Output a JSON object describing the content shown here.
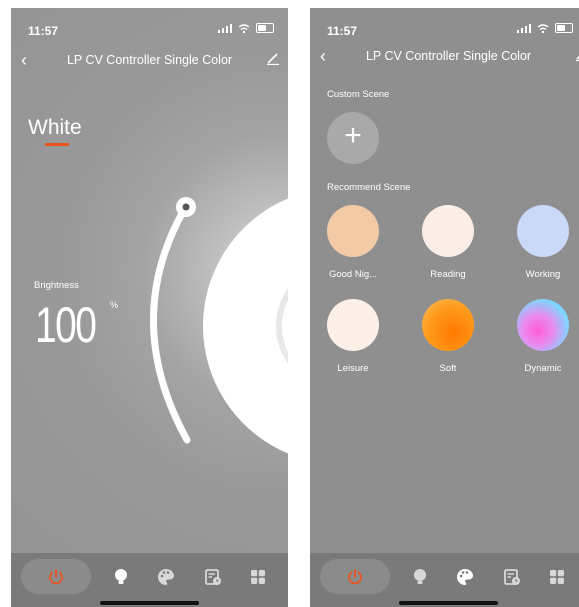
{
  "status": {
    "time": "11:57"
  },
  "nav": {
    "title": "LP CV Controller Single Color",
    "back": "‹"
  },
  "left": {
    "mode": "White",
    "brightness_label": "Brightness",
    "brightness_value": "100",
    "brightness_unit": "%",
    "brightness_percent": 100
  },
  "right": {
    "custom_scene_label": "Custom Scene",
    "add_symbol": "+",
    "recommend_scene_label": "Recommend Scene",
    "scenes": [
      {
        "name": "Good Nig...",
        "color": "#f2cba6"
      },
      {
        "name": "Reading",
        "color": "#fbeee6"
      },
      {
        "name": "Working",
        "color": "#c9d9f7"
      },
      {
        "name": "Leisure",
        "color": "#fcefe7"
      },
      {
        "name": "Soft",
        "color": "#ff8a00"
      },
      {
        "name": "Dynamic",
        "color": "gradient"
      }
    ]
  },
  "tabs": [
    {
      "name": "power-icon"
    },
    {
      "name": "bulb-icon"
    },
    {
      "name": "palette-icon"
    },
    {
      "name": "schedule-icon"
    },
    {
      "name": "grid-icon"
    }
  ],
  "colors": {
    "accent": "#e8551f",
    "background_right": "#8f8f8f",
    "tabbar": "#7a7a7a"
  }
}
